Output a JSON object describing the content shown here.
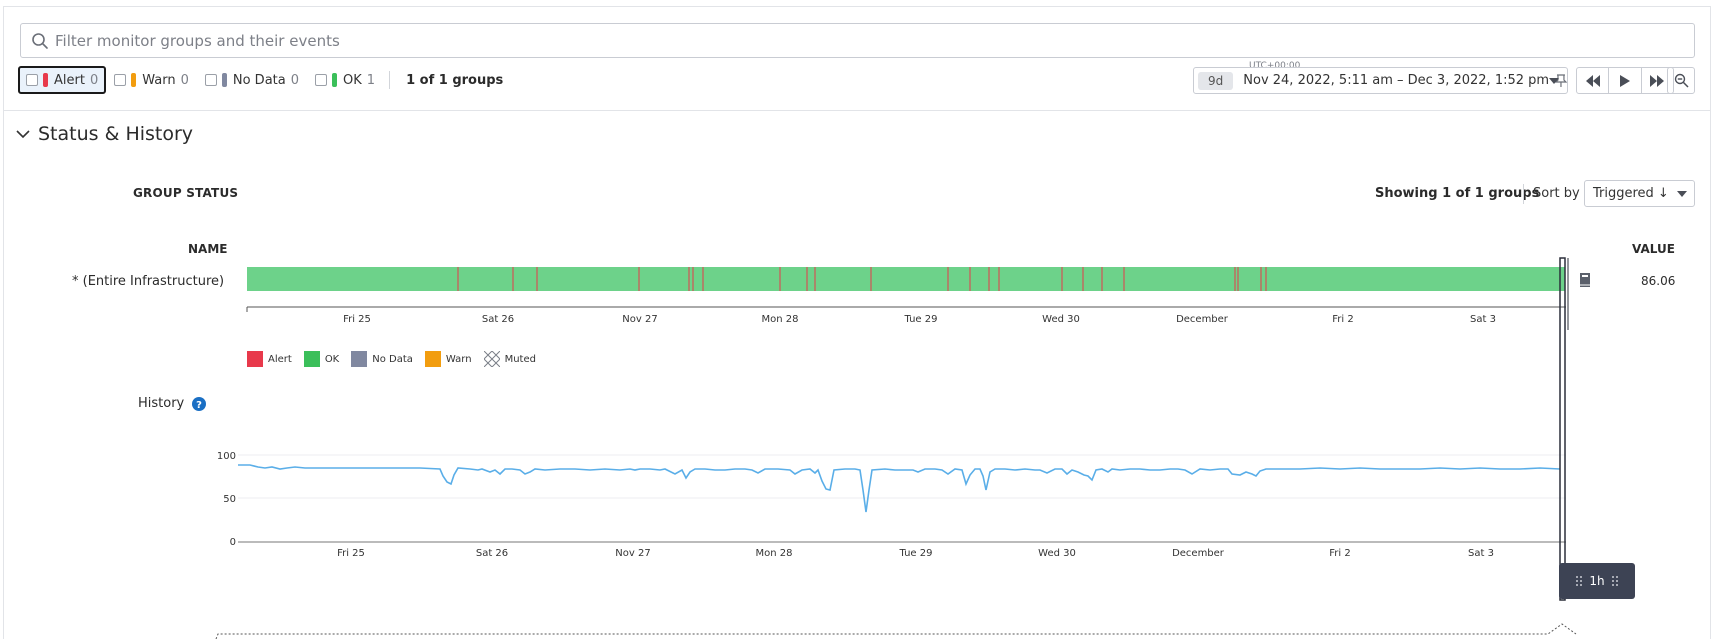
{
  "search": {
    "placeholder": "Filter monitor groups and their events"
  },
  "filters": [
    {
      "label": "Alert",
      "count": "0",
      "color": "#e8394b"
    },
    {
      "label": "Warn",
      "count": "0",
      "color": "#f29d0f"
    },
    {
      "label": "No Data",
      "count": "0",
      "color": "#8088a0"
    },
    {
      "label": "OK",
      "count": "1",
      "color": "#3bbf5a"
    }
  ],
  "groups_count": "1 of 1 groups",
  "timepicker": {
    "timezone": "UTC+00:00",
    "badge": "9d",
    "range": "Nov 24, 2022, 5:11 am – Dec 3, 2022, 1:52 pm"
  },
  "section": {
    "title": "Status & History"
  },
  "group_status": {
    "label": "GROUP STATUS",
    "showing": "Showing 1 of 1 groups",
    "sort_by_label": "Sort by",
    "sort_value": "Triggered ↓",
    "col_name": "NAME",
    "col_value": "VALUE",
    "row": {
      "name": "* (Entire Infrastructure)",
      "value": "86.06"
    },
    "ticks": [
      "Fri 25",
      "Sat 26",
      "Nov 27",
      "Mon 28",
      "Tue 29",
      "Wed 30",
      "December",
      "Fri 2",
      "Sat 3"
    ]
  },
  "legend": [
    {
      "label": "Alert",
      "color": "#e8394b"
    },
    {
      "label": "OK",
      "color": "#3bbf5a"
    },
    {
      "label": "No Data",
      "color": "#8088a0"
    },
    {
      "label": "Warn",
      "color": "#f29d0f"
    },
    {
      "label": "Muted",
      "color": "pattern"
    }
  ],
  "history": {
    "label": "History",
    "y_ticks": [
      "100",
      "50",
      "0"
    ],
    "x_ticks": [
      "Fri 25",
      "Sat 26",
      "Nov 27",
      "Mon 28",
      "Tue 29",
      "Wed 30",
      "December",
      "Fri 2",
      "Sat 3"
    ]
  },
  "window_handle": {
    "label": "1h"
  },
  "colors": {
    "ok": "#6dd28a",
    "alert_tick": "#e8394b",
    "line": "#5aaee8",
    "accent": "#1a6fc4"
  },
  "icons": [
    "search-icon",
    "pin-icon",
    "chevron-down-icon",
    "rewind-icon",
    "play-icon",
    "fast-forward-icon",
    "zoom-out-icon",
    "notebook-icon",
    "help-icon",
    "grip-icon"
  ]
}
